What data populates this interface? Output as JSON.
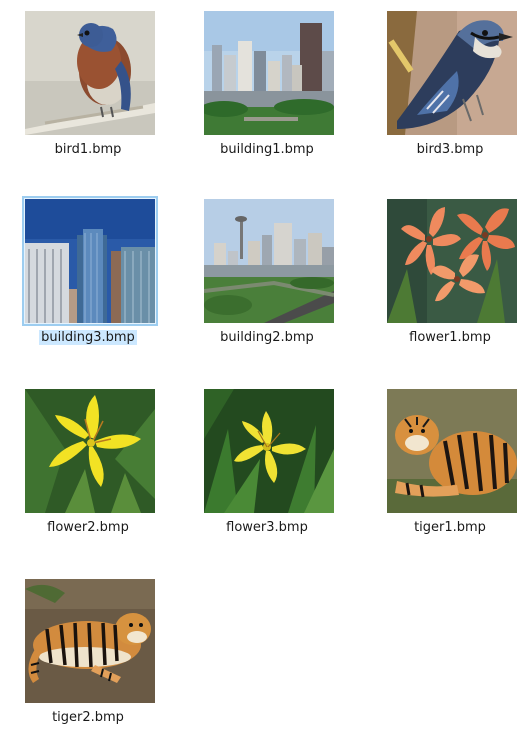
{
  "files": [
    {
      "name": "bird1.bmp",
      "thumbnail": "bluebird-on-branch",
      "selected": false
    },
    {
      "name": "building1.bmp",
      "thumbnail": "city-skyline-park",
      "selected": false
    },
    {
      "name": "bird3.bmp",
      "thumbnail": "blue-jay",
      "selected": false
    },
    {
      "name": "building3.bmp",
      "thumbnail": "glass-towers",
      "selected": true
    },
    {
      "name": "building2.bmp",
      "thumbnail": "city-skyline-road",
      "selected": false
    },
    {
      "name": "flower1.bmp",
      "thumbnail": "orange-lilies",
      "selected": false
    },
    {
      "name": "flower2.bmp",
      "thumbnail": "yellow-lily",
      "selected": false
    },
    {
      "name": "flower3.bmp",
      "thumbnail": "yellow-lily-leaves",
      "selected": false
    },
    {
      "name": "tiger1.bmp",
      "thumbnail": "tiger-resting",
      "selected": false
    },
    {
      "name": "tiger2.bmp",
      "thumbnail": "tiger-lying",
      "selected": false
    }
  ],
  "colors": {
    "selection_border": "#9dcdf0",
    "selection_label": "#cce8ff"
  }
}
